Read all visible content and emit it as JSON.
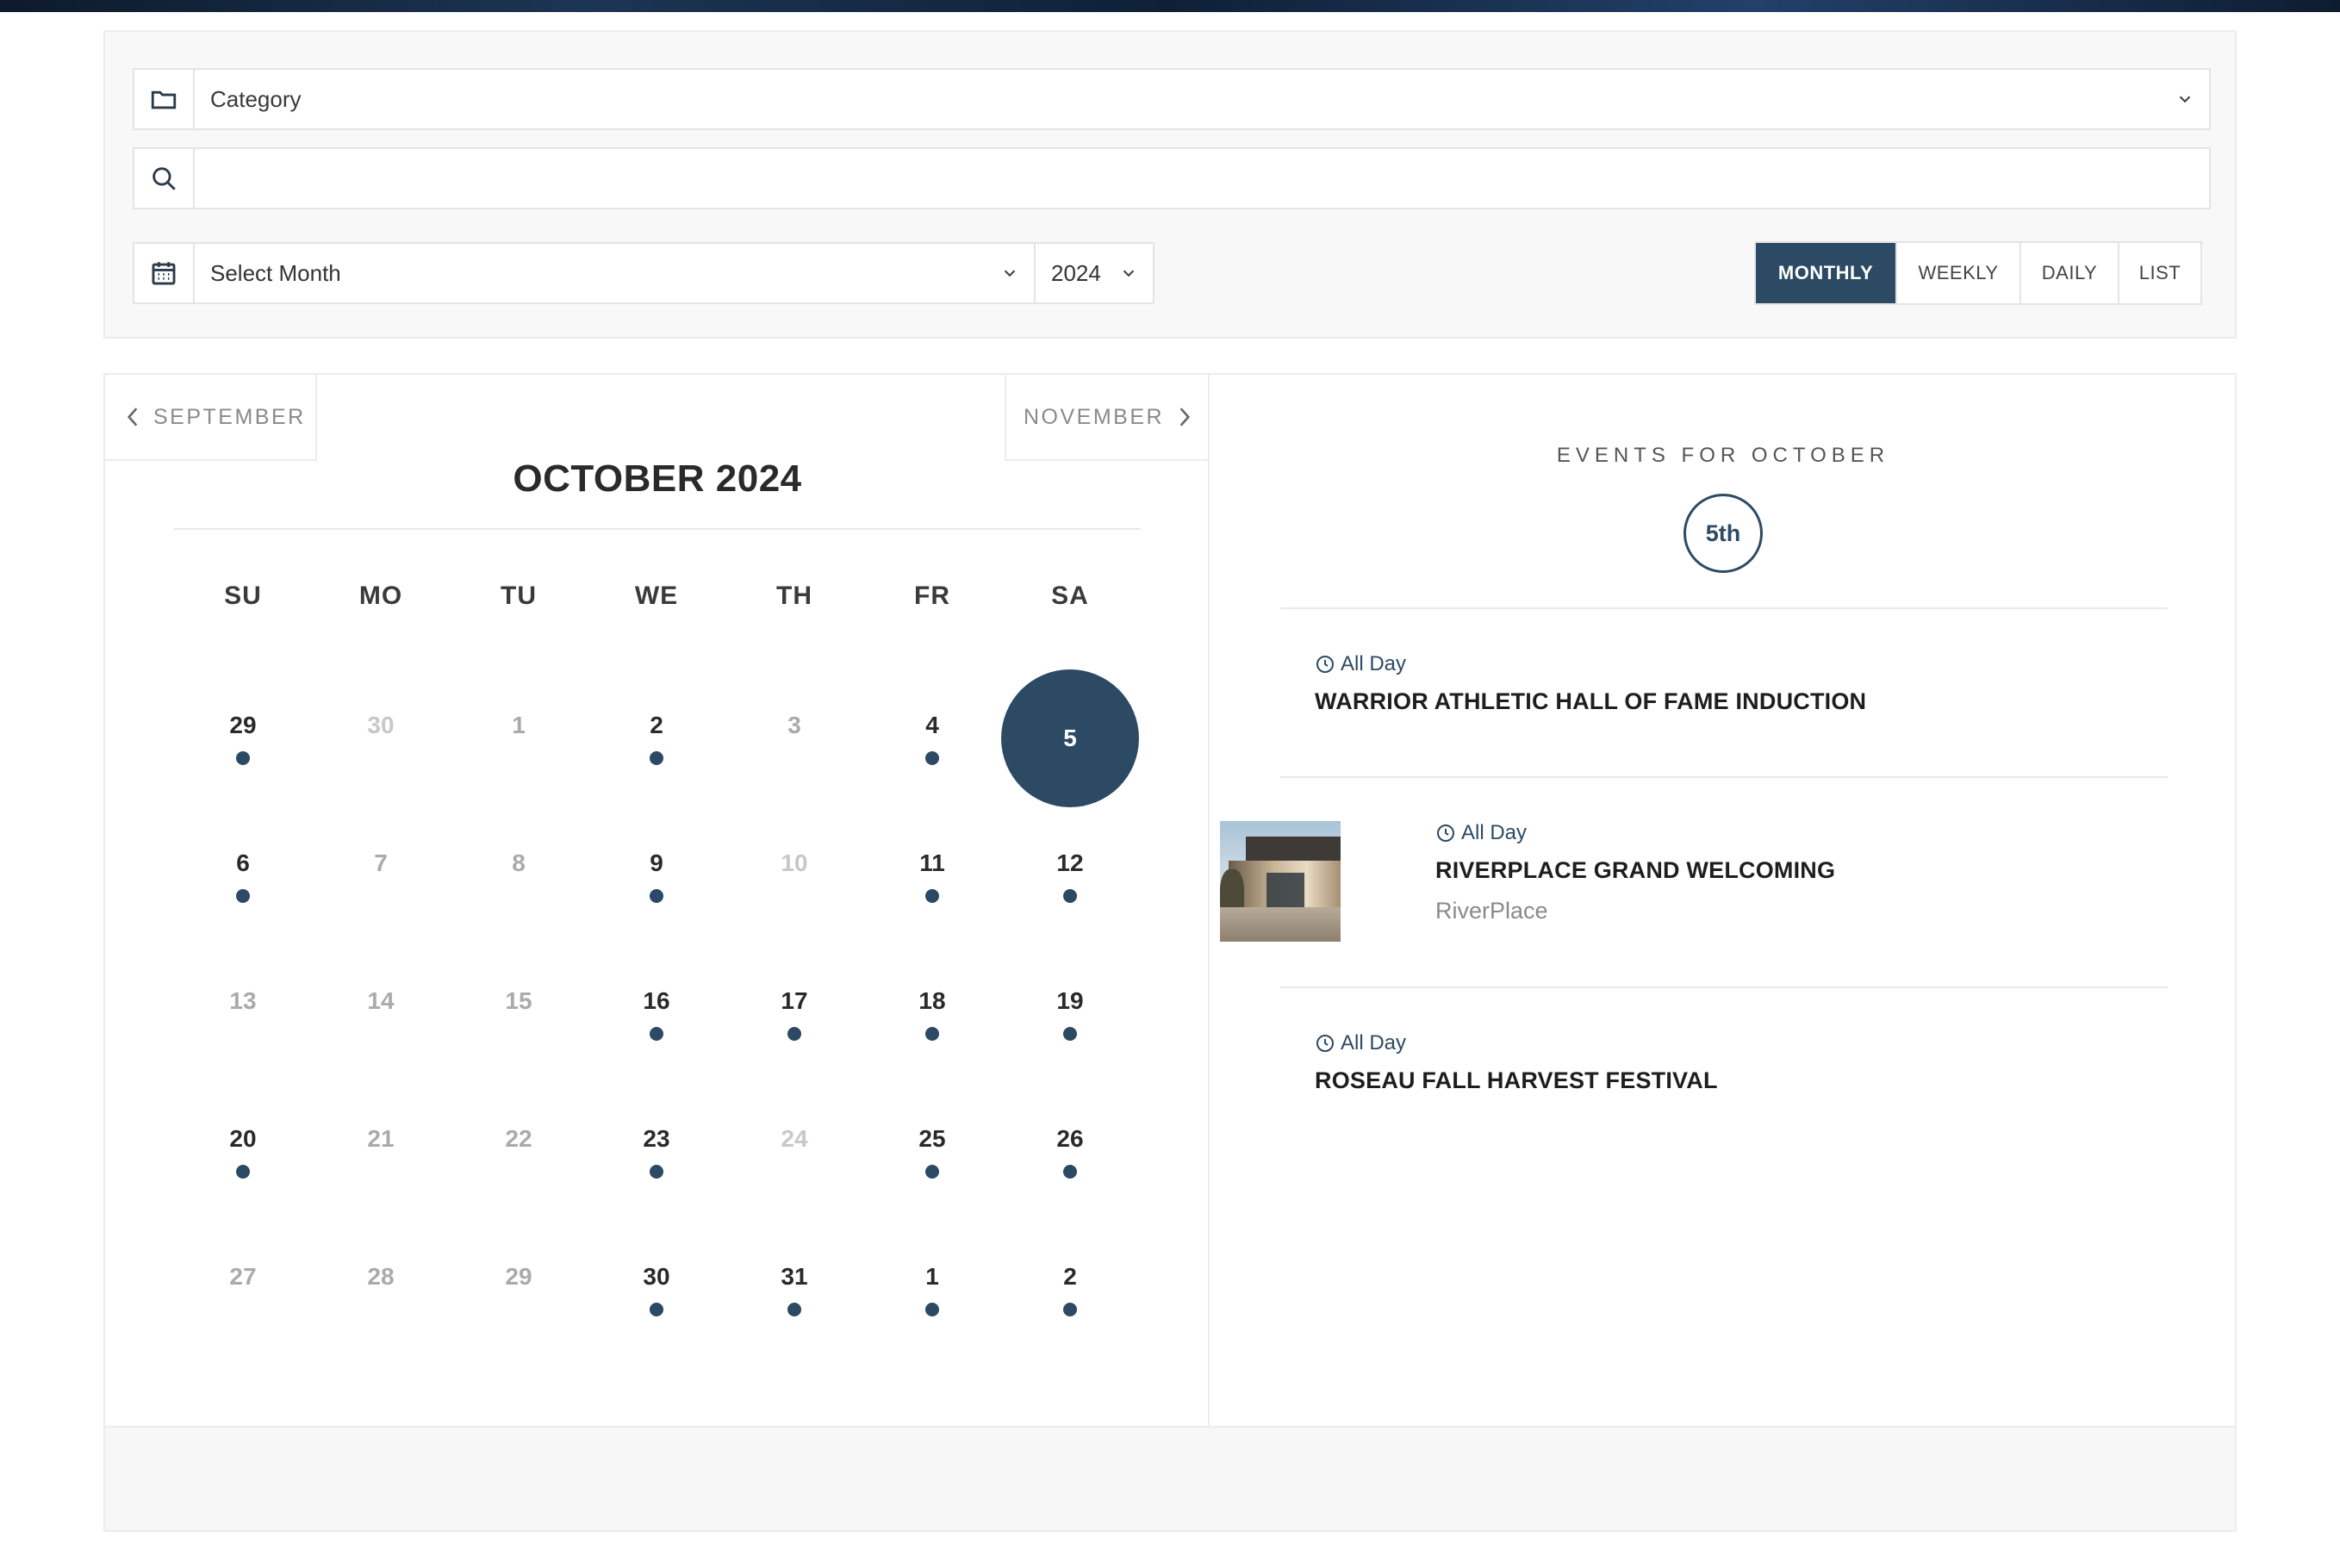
{
  "filters": {
    "category_label": "Category",
    "search_value": "",
    "month_label": "Select Month",
    "year_value": "2024"
  },
  "view_tabs": [
    {
      "label": "MONTHLY",
      "active": true
    },
    {
      "label": "WEEKLY",
      "active": false
    },
    {
      "label": "DAILY",
      "active": false
    },
    {
      "label": "LIST",
      "active": false
    }
  ],
  "calendar": {
    "prev_label": "SEPTEMBER",
    "next_label": "NOVEMBER",
    "title": "OCTOBER 2024",
    "weekdays": [
      "SU",
      "MO",
      "TU",
      "WE",
      "TH",
      "FR",
      "SA"
    ],
    "weeks": [
      [
        {
          "n": "29",
          "dot": true,
          "style": "normal"
        },
        {
          "n": "30",
          "dot": false,
          "style": "faded"
        },
        {
          "n": "1",
          "dot": false,
          "style": "muted"
        },
        {
          "n": "2",
          "dot": true,
          "style": "normal"
        },
        {
          "n": "3",
          "dot": false,
          "style": "muted"
        },
        {
          "n": "4",
          "dot": true,
          "style": "normal"
        },
        {
          "n": "5",
          "dot": false,
          "style": "selected"
        }
      ],
      [
        {
          "n": "6",
          "dot": true,
          "style": "normal"
        },
        {
          "n": "7",
          "dot": false,
          "style": "muted"
        },
        {
          "n": "8",
          "dot": false,
          "style": "muted"
        },
        {
          "n": "9",
          "dot": true,
          "style": "normal"
        },
        {
          "n": "10",
          "dot": false,
          "style": "faded"
        },
        {
          "n": "11",
          "dot": true,
          "style": "normal"
        },
        {
          "n": "12",
          "dot": true,
          "style": "normal"
        }
      ],
      [
        {
          "n": "13",
          "dot": false,
          "style": "muted"
        },
        {
          "n": "14",
          "dot": false,
          "style": "muted"
        },
        {
          "n": "15",
          "dot": false,
          "style": "muted"
        },
        {
          "n": "16",
          "dot": true,
          "style": "normal"
        },
        {
          "n": "17",
          "dot": true,
          "style": "normal"
        },
        {
          "n": "18",
          "dot": true,
          "style": "normal"
        },
        {
          "n": "19",
          "dot": true,
          "style": "normal"
        }
      ],
      [
        {
          "n": "20",
          "dot": true,
          "style": "normal"
        },
        {
          "n": "21",
          "dot": false,
          "style": "muted"
        },
        {
          "n": "22",
          "dot": false,
          "style": "muted"
        },
        {
          "n": "23",
          "dot": true,
          "style": "normal"
        },
        {
          "n": "24",
          "dot": false,
          "style": "faded"
        },
        {
          "n": "25",
          "dot": true,
          "style": "normal"
        },
        {
          "n": "26",
          "dot": true,
          "style": "normal"
        }
      ],
      [
        {
          "n": "27",
          "dot": false,
          "style": "muted"
        },
        {
          "n": "28",
          "dot": false,
          "style": "muted"
        },
        {
          "n": "29",
          "dot": false,
          "style": "muted"
        },
        {
          "n": "30",
          "dot": true,
          "style": "normal"
        },
        {
          "n": "31",
          "dot": true,
          "style": "normal"
        },
        {
          "n": "1",
          "dot": true,
          "style": "normal"
        },
        {
          "n": "2",
          "dot": true,
          "style": "normal"
        }
      ]
    ]
  },
  "events_panel": {
    "heading": "EVENTS FOR OCTOBER",
    "day_badge": "5th",
    "events": [
      {
        "time": "All Day",
        "title": "WARRIOR ATHLETIC HALL OF FAME INDUCTION",
        "location": "",
        "has_image": false
      },
      {
        "time": "All Day",
        "title": "RIVERPLACE GRAND WELCOMING",
        "location": "RiverPlace",
        "has_image": true
      },
      {
        "time": "All Day",
        "title": "ROSEAU FALL HARVEST FESTIVAL",
        "location": "",
        "has_image": false
      }
    ]
  },
  "colors": {
    "accent": "#2c4a63",
    "muted_text": "#aaaaaa",
    "panel_bg": "#f8f8f8"
  },
  "icons": {
    "category": "folder-icon",
    "search": "search-icon",
    "month": "calendar-icon",
    "dropdown": "chevron-down-icon",
    "prev": "chevron-left-icon",
    "next": "chevron-right-icon",
    "time": "clock-icon"
  }
}
